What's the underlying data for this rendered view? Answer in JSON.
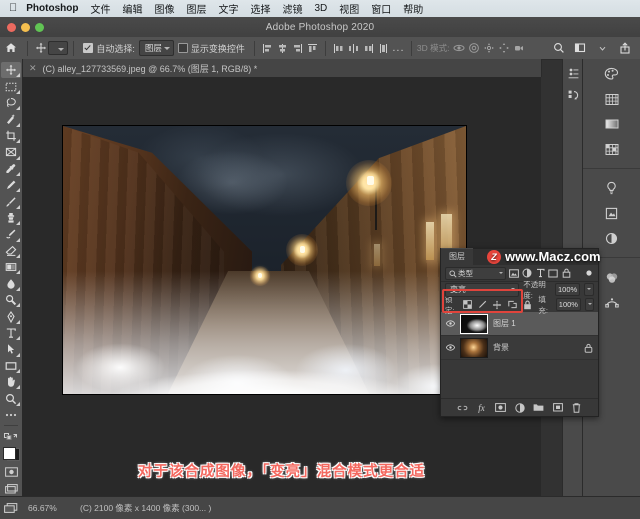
{
  "menubar": {
    "apple_icon": "apple-icon",
    "items": [
      {
        "label": "Photoshop",
        "bold": true
      },
      {
        "label": "文件",
        "bold": false
      },
      {
        "label": "编辑",
        "bold": false
      },
      {
        "label": "图像",
        "bold": false
      },
      {
        "label": "图层",
        "bold": false
      },
      {
        "label": "文字",
        "bold": false
      },
      {
        "label": "选择",
        "bold": false
      },
      {
        "label": "滤镜",
        "bold": false
      },
      {
        "label": "3D",
        "bold": false
      },
      {
        "label": "视图",
        "bold": false
      },
      {
        "label": "窗口",
        "bold": false
      },
      {
        "label": "帮助",
        "bold": false
      }
    ]
  },
  "window": {
    "title": "Adobe Photoshop 2020"
  },
  "options_bar": {
    "home_icon": "home-icon",
    "move_tool_icon": "move-tool-icon",
    "auto_select_label": "自动选择:",
    "auto_select_checked": true,
    "auto_select_scope": "图层",
    "show_transform_label": "显示变换控件",
    "show_transform_checked": false,
    "more_label": "...",
    "mode_3d_label": "3D 模式:",
    "search_icon": "search-icon",
    "arrange_icon": "arrange-documents-icon",
    "share_icon": "share-icon"
  },
  "document_tab": {
    "close_icon": "close-icon",
    "title": "(C) alley_127733569.jpeg @ 66.7% (图层 1, RGB/8) *"
  },
  "toolbar": {
    "tools": [
      {
        "name": "move-tool",
        "active": true
      },
      {
        "name": "rectangular-marquee-tool",
        "active": false
      },
      {
        "name": "lasso-tool",
        "active": false
      },
      {
        "name": "quick-selection-tool",
        "active": false
      },
      {
        "name": "crop-tool",
        "active": false
      },
      {
        "name": "frame-tool",
        "active": false
      },
      {
        "name": "eyedropper-tool",
        "active": false
      },
      {
        "name": "spot-healing-brush-tool",
        "active": false
      },
      {
        "name": "brush-tool",
        "active": false
      },
      {
        "name": "clone-stamp-tool",
        "active": false
      },
      {
        "name": "history-brush-tool",
        "active": false
      },
      {
        "name": "eraser-tool",
        "active": false
      },
      {
        "name": "gradient-tool",
        "active": false
      },
      {
        "name": "blur-tool",
        "active": false
      },
      {
        "name": "dodge-tool",
        "active": false
      },
      {
        "name": "pen-tool",
        "active": false
      },
      {
        "name": "type-tool",
        "active": false
      },
      {
        "name": "path-selection-tool",
        "active": false
      },
      {
        "name": "rectangle-tool",
        "active": false
      },
      {
        "name": "hand-tool",
        "active": false
      },
      {
        "name": "zoom-tool",
        "active": false
      },
      {
        "name": "edit-toolbar-tool",
        "active": false
      }
    ],
    "foreground_color": "#ffffff",
    "background_color": "#1b1b1b",
    "quick_mask_icon": "quick-mask-icon",
    "screen_mode_icon": "screen-mode-icon"
  },
  "canvas": {
    "image_alt": "夜晚的小巷合成图像（烟雾图层叠加）",
    "caption": "对于该合成图像，「变亮」混合模式更合适"
  },
  "right_dock_mini": {
    "icons": [
      "history-panel-icon",
      "actions-panel-icon"
    ]
  },
  "right_dock": {
    "icons": [
      "color-panel-icon",
      "swatches-panel-icon",
      "gradients-panel-icon",
      "patterns-panel-icon",
      "adjustments-panel-icon",
      "styles-panel-icon",
      "layers-comps-panel-icon",
      "libraries-panel-icon",
      "paths-panel-icon"
    ]
  },
  "layers_panel": {
    "tab_label": "图层",
    "filter": {
      "search_icon": "search-icon",
      "kind_label": "类型",
      "icons": [
        "filter-pixel-icon",
        "filter-adjustment-icon",
        "filter-type-icon",
        "filter-shape-icon",
        "filter-smartobject-icon"
      ],
      "toggle_icon": "filter-toggle-icon"
    },
    "blend_mode": "变亮",
    "opacity_label": "不透明度:",
    "opacity_value": "100%",
    "lock_label": "锁定:",
    "lock_icons": [
      "lock-transparent-pixels-icon",
      "lock-image-pixels-icon",
      "lock-position-icon",
      "lock-artboard-nesting-icon",
      "lock-all-icon"
    ],
    "fill_label": "填充:",
    "fill_value": "100%",
    "layers": [
      {
        "name": "图层 1",
        "visible": true,
        "selected": true,
        "locked": false,
        "thumb": "smoke"
      },
      {
        "name": "背景",
        "visible": true,
        "selected": false,
        "locked": true,
        "thumb": "alley"
      }
    ],
    "bottom_icons": [
      "link-layers-icon",
      "layer-style-fx-icon",
      "add-layer-mask-icon",
      "new-adjustment-layer-icon",
      "new-group-icon",
      "new-layer-icon",
      "delete-layer-icon"
    ],
    "highlight_color": "#e0443c"
  },
  "watermark": {
    "badge": "Z",
    "text": "www.Macz.com"
  },
  "status_bar": {
    "screen_icon": "document-arrange-icon",
    "zoom": "66.67%",
    "doc_info": "(C) 2100 像素 x 1400 像素 (300... )"
  }
}
